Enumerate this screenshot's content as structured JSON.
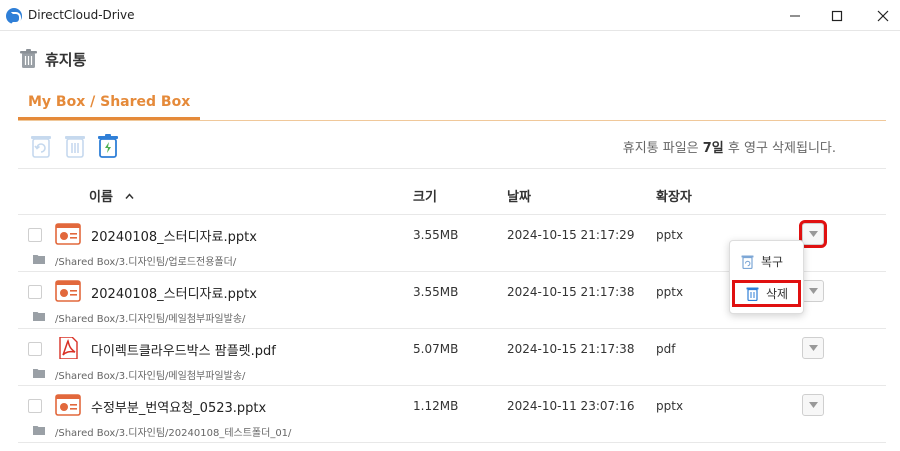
{
  "window": {
    "title": "DirectCloud-Drive"
  },
  "page": {
    "title": "휴지통"
  },
  "tabs": [
    {
      "label": "My Box / Shared Box",
      "active": true
    }
  ],
  "toolbar": {
    "icons": [
      "restore-icon",
      "delete-icon",
      "empty-trash-icon"
    ],
    "notice_prefix": "휴지통 파일은 ",
    "notice_days": "7일",
    "notice_suffix": " 후 영구 삭제됩니다."
  },
  "table": {
    "columns": {
      "name": "이름",
      "size": "크기",
      "date": "날짜",
      "ext": "확장자"
    },
    "rows": [
      {
        "name": "20240108_스터디자료.pptx",
        "size": "3.55MB",
        "date": "2024-10-15 21:17:29",
        "ext": "pptx",
        "path": "/Shared Box/3.디자인팀/업로드전용폴더/",
        "icon": "pptx-file-icon"
      },
      {
        "name": "20240108_스터디자료.pptx",
        "size": "3.55MB",
        "date": "2024-10-15 21:17:38",
        "ext": "pptx",
        "path": "/Shared Box/3.디자인팀/메일첨부파일발송/",
        "icon": "pptx-file-icon"
      },
      {
        "name": "다이렉트클라우드박스 팜플렛.pdf",
        "size": "5.07MB",
        "date": "2024-10-15 21:17:38",
        "ext": "pdf",
        "path": "/Shared Box/3.디자인팀/메일첨부파일발송/",
        "icon": "pdf-file-icon"
      },
      {
        "name": "수정부분_번역요청_0523.pptx",
        "size": "1.12MB",
        "date": "2024-10-11 23:07:16",
        "ext": "pptx",
        "path": "/Shared Box/3.디자인팀/20240108_테스트폴더_01/",
        "icon": "pptx-file-icon"
      }
    ]
  },
  "context_menu": {
    "restore_label": "복구",
    "delete_label": "삭제"
  },
  "colors": {
    "accent": "#e58a3a",
    "highlight": "#e01010",
    "icon_blue": "#2f7fd7"
  }
}
